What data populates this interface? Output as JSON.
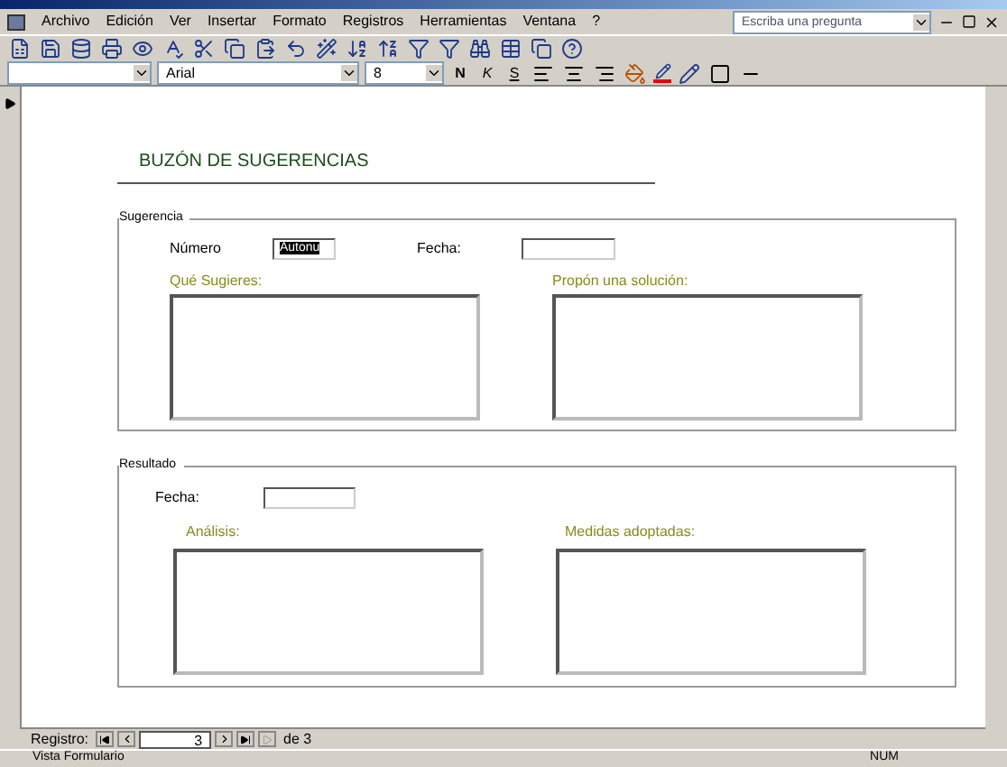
{
  "menu": [
    "Archivo",
    "Edición",
    "Ver",
    "Insertar",
    "Formato",
    "Registros",
    "Herramientas",
    "Ventana",
    "?"
  ],
  "help_box": {
    "placeholder": "Escriba una pregunta"
  },
  "format_toolbar": {
    "font": "Arial",
    "size": "8",
    "style_buttons": [
      "N",
      "K",
      "S"
    ]
  },
  "form": {
    "title": "BUZÓN DE SUGERENCIAS",
    "suggestion": {
      "legend": "Sugerencia",
      "number_label": "Número",
      "number_value": "Autonu",
      "number_highlighted": true,
      "date_label": "Fecha:",
      "memo_left": "Qué Sugieres:",
      "memo_right": "Propón una solución:"
    },
    "result": {
      "legend": "Resultado",
      "date_label": "Fecha:",
      "memo_left": "Análisis:",
      "memo_right": "Medidas adoptadas:"
    }
  },
  "navigation": {
    "label": "Registro:",
    "current": "3",
    "total": "de 3"
  },
  "status_bar": {
    "view": "Vista Formulario",
    "indicator": "NUM"
  }
}
